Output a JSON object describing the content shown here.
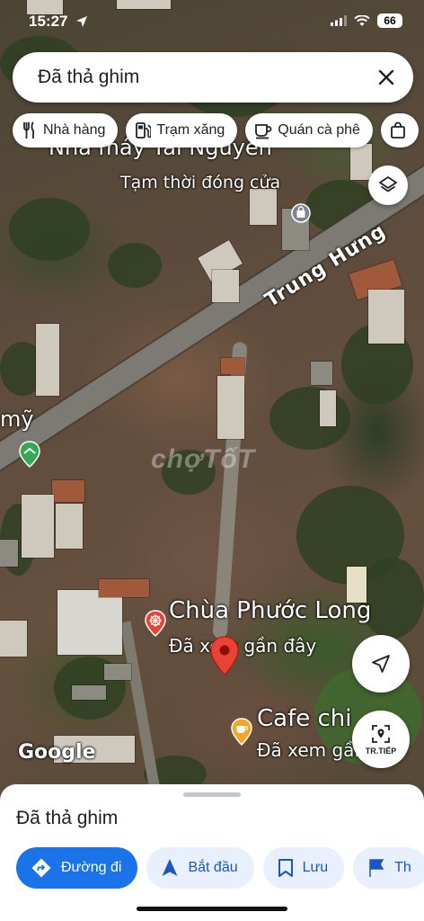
{
  "status_bar": {
    "time": "15:27",
    "battery": "66"
  },
  "search": {
    "query": "Đã thả ghim"
  },
  "chips": [
    {
      "label": "Nhà hàng",
      "icon": "fork-knife-icon"
    },
    {
      "label": "Trạm xăng",
      "icon": "gas-station-icon"
    },
    {
      "label": "Quán cà phê",
      "icon": "coffee-cup-icon"
    }
  ],
  "map": {
    "labels": {
      "factory_name": "Nhà máy Tài Nguyên",
      "factory_status": "Tạm thời đóng cửa",
      "road_name": "Trung Hưng",
      "left_fragment": "mỹ",
      "temple_name": "Chùa Phước Long",
      "temple_sub": "Đã xem gần đây",
      "cafe_name": "Cafe chi",
      "cafe_sub": "Đã xem gần đây",
      "google": "Google",
      "watermark": "chợTốT"
    },
    "next_button_label": "TR.TIẾP"
  },
  "sheet": {
    "title": "Đã thả ghim",
    "actions": [
      {
        "label": "Đường đi",
        "icon": "directions-icon"
      },
      {
        "label": "Bắt đầu",
        "icon": "navigation-arrow-icon"
      },
      {
        "label": "Lưu",
        "icon": "bookmark-icon"
      },
      {
        "label": "Th",
        "icon": "flag-icon"
      }
    ]
  },
  "colors": {
    "accent": "#1a73e8",
    "pin": "#ea4335",
    "cafe": "#f5a623"
  }
}
